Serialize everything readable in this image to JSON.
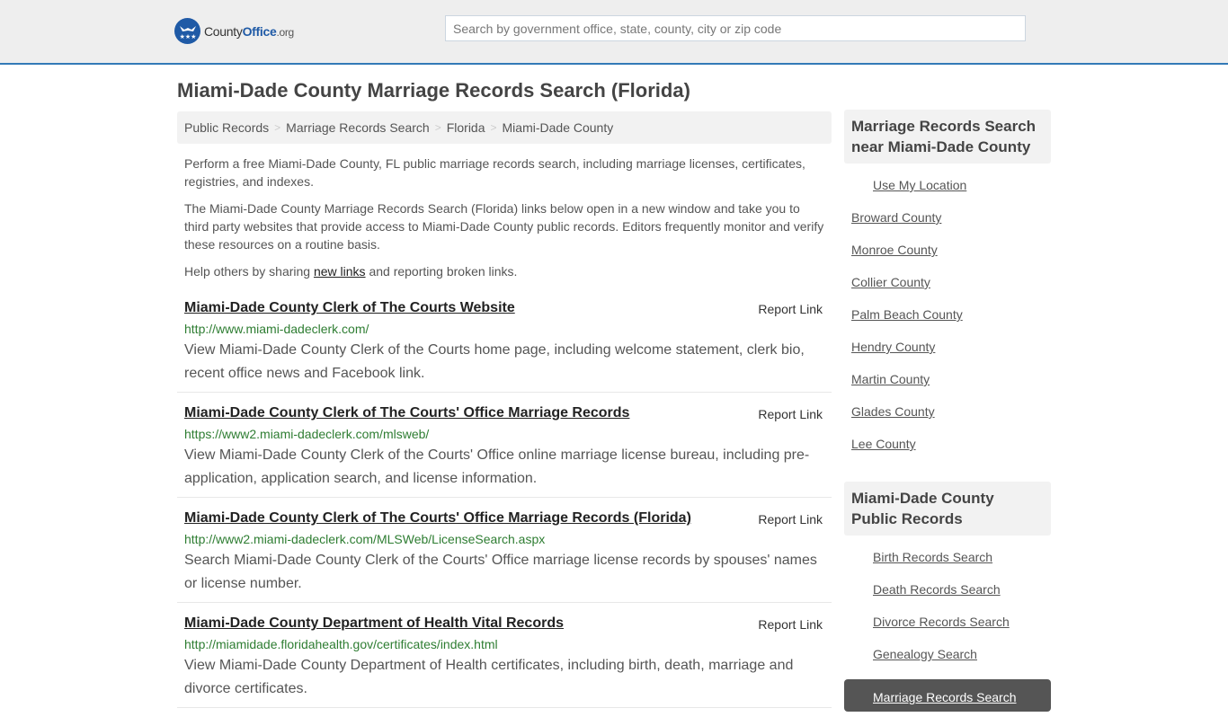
{
  "header": {
    "logo": {
      "county": "County",
      "office": "Office",
      "tld": ".org",
      "icon": "eagle-stars-badge-icon",
      "color": "#1f5aa6"
    },
    "search_placeholder": "Search by government office, state, county, city or zip code",
    "search_value": ""
  },
  "page_title": "Miami-Dade County Marriage Records Search (Florida)",
  "breadcrumb": [
    "Public Records",
    "Marriage Records Search",
    "Florida",
    "Miami-Dade County"
  ],
  "intro": {
    "p1": "Perform a free Miami-Dade County, FL public marriage records search, including marriage licenses, certificates, registries, and indexes.",
    "p2": "The Miami-Dade County Marriage Records Search (Florida) links below open in a new window and take you to third party websites that provide access to Miami-Dade County public records. Editors frequently monitor and verify these resources on a routine basis.",
    "p3_before": "Help others by sharing ",
    "p3_link": "new links",
    "p3_after": " and reporting broken links."
  },
  "results": [
    {
      "title": "Miami-Dade County Clerk of The Courts Website",
      "url": "http://www.miami-dadeclerk.com/",
      "description": "View Miami-Dade County Clerk of the Courts home page, including welcome statement, clerk bio, recent office news and Facebook link.",
      "report_label": "Report Link"
    },
    {
      "title": "Miami-Dade County Clerk of The Courts' Office Marriage Records",
      "url": "https://www2.miami-dadeclerk.com/mlsweb/",
      "description": "View Miami-Dade County Clerk of the Courts' Office online marriage license bureau, including pre-application, application search, and license information.",
      "report_label": "Report Link"
    },
    {
      "title": "Miami-Dade County Clerk of The Courts' Office Marriage Records (Florida)",
      "url": "http://www2.miami-dadeclerk.com/MLSWeb/LicenseSearch.aspx",
      "description": "Search Miami-Dade County Clerk of the Courts' Office marriage license records by spouses' names or license number.",
      "report_label": "Report Link"
    },
    {
      "title": "Miami-Dade County Department of Health Vital Records",
      "url": "http://miamidade.floridahealth.gov/certificates/index.html",
      "description": "View Miami-Dade County Department of Health certificates, including birth, death, marriage and divorce certificates.",
      "report_label": "Report Link"
    }
  ],
  "sidebar": {
    "nearby": {
      "heading": "Marriage Records Search near Miami-Dade County",
      "use_location": "Use My Location",
      "counties": [
        "Broward County",
        "Monroe County",
        "Collier County",
        "Palm Beach County",
        "Hendry County",
        "Martin County",
        "Glades County",
        "Lee County"
      ]
    },
    "public_records": {
      "heading": "Miami-Dade County Public Records",
      "items": [
        "Birth Records Search",
        "Death Records Search",
        "Divorce Records Search",
        "Genealogy Search",
        "Marriage Records Search"
      ],
      "active": "Marriage Records Search"
    }
  }
}
